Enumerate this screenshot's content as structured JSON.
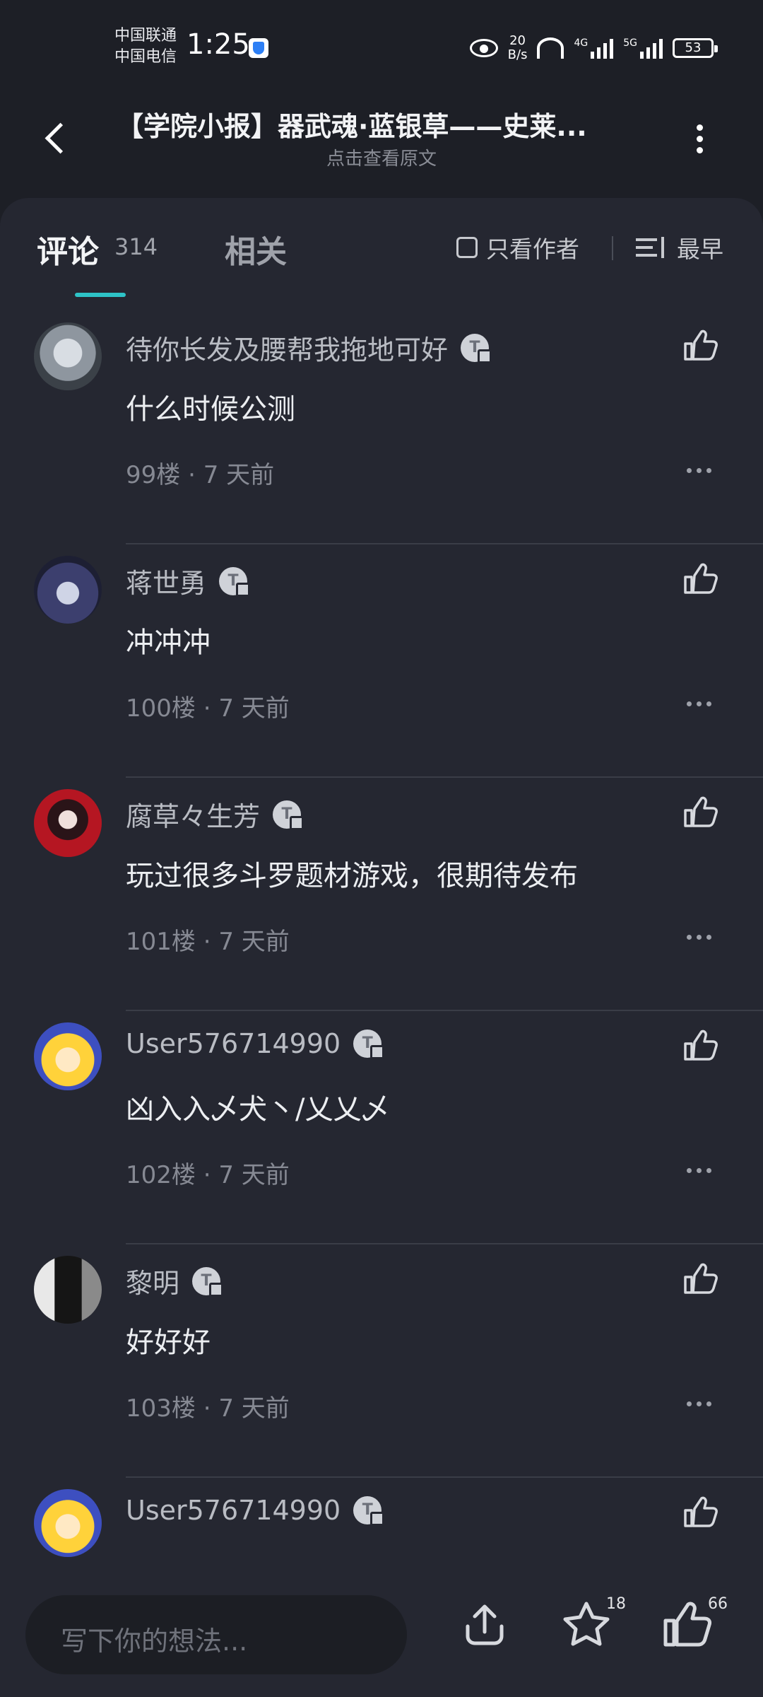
{
  "status": {
    "carrier1": "中国联通",
    "carrier2": "中国电信",
    "time": "1:25",
    "net_speed_value": "20",
    "net_speed_unit": "B/s",
    "sig1_label": "4G",
    "sig2_label": "5G",
    "battery": "53"
  },
  "header": {
    "title": "【学院小报】器武魂·蓝银草——史莱...",
    "subtitle": "点击查看原文"
  },
  "tabs": {
    "comments_label": "评论",
    "comments_count": "314",
    "related_label": "相关",
    "author_only_label": "只看作者",
    "sort_label": "最早"
  },
  "comments": [
    {
      "user": "待你长发及腰帮我拖地可好",
      "text": "什么时候公测",
      "floor": "99楼",
      "time": "7 天前"
    },
    {
      "user": "蒋世勇",
      "text": "冲冲冲",
      "floor": "100楼",
      "time": "7 天前"
    },
    {
      "user": "腐草々生芳",
      "text": "玩过很多斗罗题材游戏，很期待发布",
      "floor": "101楼",
      "time": "7 天前"
    },
    {
      "user": "User576714990",
      "text": "凶入入乄犬丶/乂乂乄",
      "floor": "102楼",
      "time": "7 天前"
    },
    {
      "user": "黎明",
      "text": "好好好",
      "floor": "103楼",
      "time": "7 天前"
    },
    {
      "user": "User576714990",
      "text": "",
      "floor": "",
      "time": ""
    }
  ],
  "badge_letter": "T",
  "bottom": {
    "input_placeholder": "写下你的想法...",
    "favorite_count": "18",
    "like_count": "66"
  },
  "colors": {
    "background": "#1d1f26",
    "panel": "#252731",
    "accent": "#2ec3c7"
  }
}
